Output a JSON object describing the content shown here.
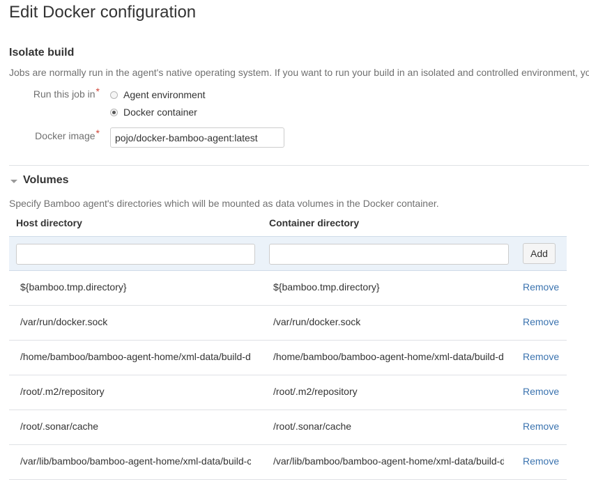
{
  "page": {
    "title": "Edit Docker configuration"
  },
  "isolate": {
    "title": "Isolate build",
    "description": "Jobs are normally run in the agent's native operating system. If you want to run your build in an isolated and controlled environment, yo",
    "run_label": "Run this job in",
    "required_mark": "*",
    "options": [
      {
        "label": "Agent environment",
        "checked": false
      },
      {
        "label": "Docker container",
        "checked": true
      }
    ],
    "image_label": "Docker image",
    "image_value": "pojo/docker-bamboo-agent:latest"
  },
  "volumes": {
    "title": "Volumes",
    "description": "Specify Bamboo agent's directories which will be mounted as data volumes in the Docker container.",
    "header_host": "Host directory",
    "header_container": "Container directory",
    "add_host_value": "",
    "add_container_value": "",
    "add_label": "Add",
    "remove_label": "Remove",
    "rows": [
      {
        "host": "${bamboo.tmp.directory}",
        "container": "${bamboo.tmp.directory}"
      },
      {
        "host": "/var/run/docker.sock",
        "container": "/var/run/docker.sock"
      },
      {
        "host": "/home/bamboo/bamboo-agent-home/xml-data/build-d",
        "container": "/home/bamboo/bamboo-agent-home/xml-data/build-di"
      },
      {
        "host": "/root/.m2/repository",
        "container": "/root/.m2/repository"
      },
      {
        "host": "/root/.sonar/cache",
        "container": "/root/.sonar/cache"
      },
      {
        "host": "/var/lib/bamboo/bamboo-agent-home/xml-data/build-c",
        "container": "/var/lib/bamboo/bamboo-agent-home/xml-data/build-d"
      }
    ]
  },
  "colors": {
    "link": "#3b73af",
    "required": "#d04437",
    "add_row_bg": "#ebf2f9"
  }
}
